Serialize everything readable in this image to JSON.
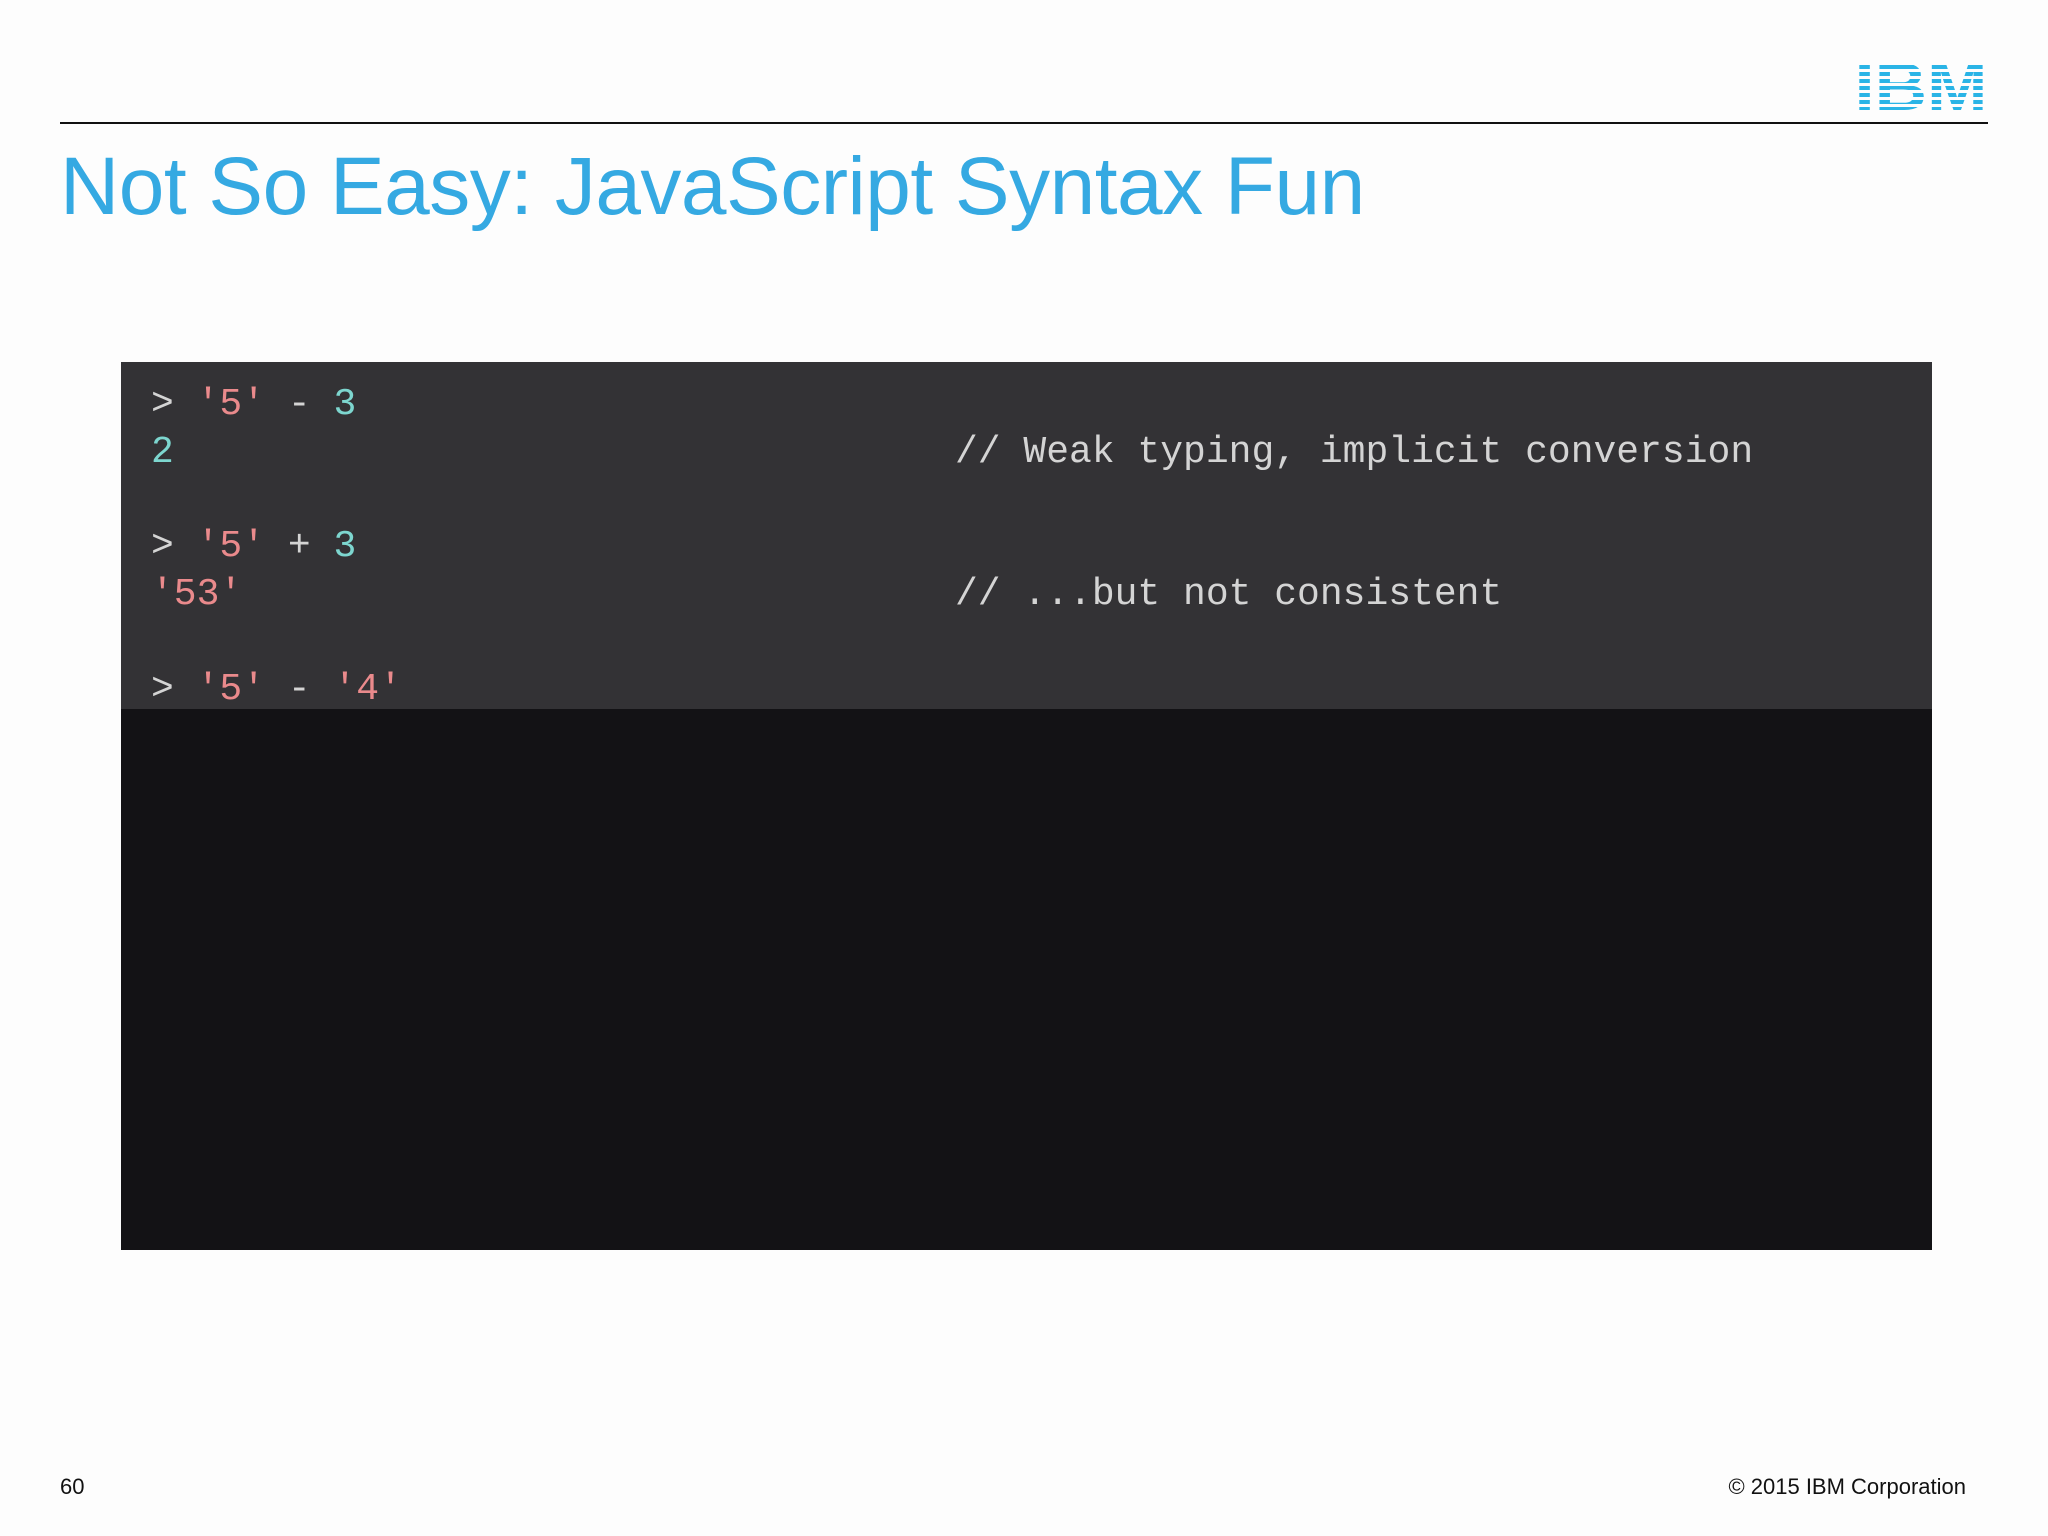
{
  "slide": {
    "title": "Not So Easy: JavaScript Syntax Fun",
    "logo_text": "IBM",
    "page_number": "60",
    "copyright": "© 2015 IBM Corporation",
    "accent_color": "#35a9e2"
  },
  "code": {
    "lines": [
      {
        "prompt": ">",
        "left": "'5'",
        "op": "-",
        "right": "3"
      },
      {
        "result": "2",
        "comment": "// Weak typing, implicit conversion"
      },
      {
        "prompt": ">",
        "left": "'5'",
        "op": "+",
        "right": "3"
      },
      {
        "result": "'53'",
        "comment": "// ...but not consistent"
      },
      {
        "prompt": ">",
        "left": "'5'",
        "op": "-",
        "right": "'4'"
      }
    ]
  }
}
